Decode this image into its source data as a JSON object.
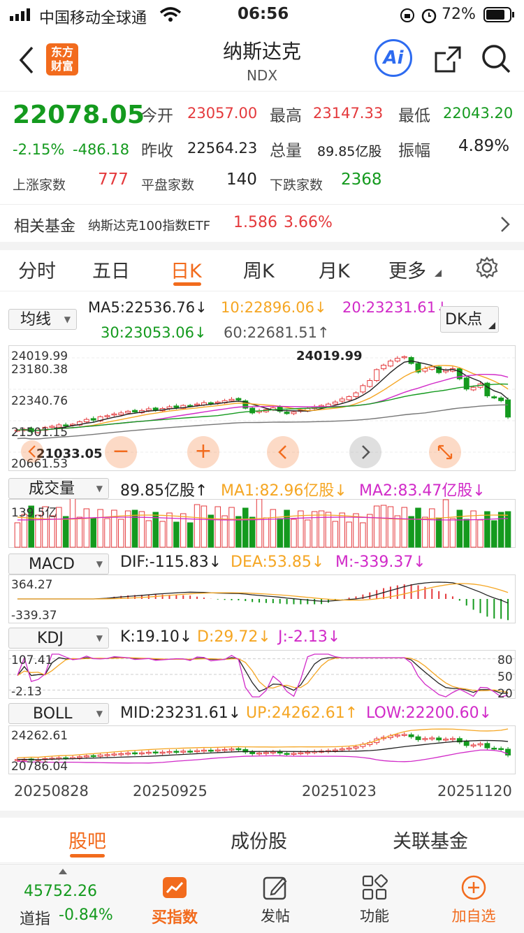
{
  "status_bar": {
    "carrier": "中国移动全球通",
    "time": "06:56",
    "battery": "72%"
  },
  "nav": {
    "logo_line1": "东方",
    "logo_line2": "财富",
    "title": "纳斯达克",
    "subtitle": "NDX",
    "ai_label": "Ai"
  },
  "quote": {
    "price": "22078.05",
    "change_pct": "-2.15%",
    "change_abs": "-486.18",
    "open_label": "今开",
    "open": "23057.00",
    "high_label": "最高",
    "high": "23147.33",
    "low_label": "最低",
    "low": "22043.20",
    "prev_label": "昨收",
    "prev": "22564.23",
    "vol_label": "总量",
    "vol": "89.85亿股",
    "amp_label": "振幅",
    "amp": "4.89%",
    "up_label": "上涨家数",
    "up": "777",
    "flat_label": "平盘家数",
    "flat": "140",
    "down_label": "下跌家数",
    "down": "2368"
  },
  "fund": {
    "label": "相关基金",
    "name": "纳斯达克100指数ETF",
    "price": "1.586",
    "pct": "3.66%"
  },
  "tabs": [
    "分时",
    "五日",
    "日K",
    "周K",
    "月K",
    "更多"
  ],
  "active_tab": "日K",
  "ma": {
    "selector": "均线",
    "ma5": "MA5:22536.76↓",
    "ma10": "10:22896.06↓",
    "ma20": "20:23231.61↓",
    "ma30": "30:23053.06↓",
    "ma60": "60:22681.51↑",
    "dk": "DK点"
  },
  "kline_axis": {
    "y1": "24019.99",
    "y2": "23180.38",
    "y3": "22340.76",
    "y4": "21501.15",
    "y5": "20661.53",
    "max_label": "24019.99",
    "min_label": "21033.05"
  },
  "volume": {
    "selector": "成交量",
    "value": "89.85亿股↑",
    "ma1": "MA1:82.96亿股↓",
    "ma2": "MA2:83.47亿股↓",
    "axis": "139.5亿"
  },
  "macd": {
    "selector": "MACD",
    "dif": "DIF:-115.83↓",
    "dea": "DEA:53.85↓",
    "m": "M:-339.37↓",
    "axis_top": "364.27",
    "axis_bottom": "-339.37"
  },
  "kdj": {
    "selector": "KDJ",
    "k": "K:19.10↓",
    "d": "D:29.72↓",
    "j": "J:-2.13↓",
    "axis_top": "107.41",
    "axis_bottom": "-2.13",
    "r80": "80",
    "r50": "50",
    "r20": "20"
  },
  "boll": {
    "selector": "BOLL",
    "mid": "MID:23231.61↓",
    "up": "UP:24262.61↑",
    "low": "LOW:22200.60↓",
    "axis_top": "24262.61",
    "axis_bottom": "20786.04"
  },
  "dates": [
    "20250828",
    "20250925",
    "20251023",
    "20251120"
  ],
  "bottom_tabs": [
    "股吧",
    "成份股",
    "关联基金"
  ],
  "bottom_bar": {
    "index_value": "45752.26",
    "index_name": "道指",
    "index_pct": "-0.84%",
    "buy": "买指数",
    "post": "发帖",
    "func": "功能",
    "add": "加自选"
  },
  "colors": {
    "up": "#e4393c",
    "down": "#149a1e",
    "accent": "#f26b1d",
    "ma10": "#f5a623",
    "ma20": "#d12ac8"
  },
  "chart_data": {
    "type": "candlestick",
    "closes": [
      21700,
      21720,
      21650,
      21690,
      21780,
      21810,
      21850,
      21830,
      21870,
      21940,
      22010,
      21990,
      22090,
      22120,
      22170,
      22200,
      22250,
      22230,
      22270,
      22320,
      22290,
      22330,
      22380,
      22360,
      22420,
      22410,
      22460,
      22500,
      22470,
      22520,
      22560,
      22600,
      22580,
      22340,
      22200,
      22260,
      22300,
      22350,
      22250,
      22180,
      22230,
      22280,
      22330,
      22380,
      22420,
      22460,
      22520,
      22610,
      22680,
      22790,
      23000,
      23150,
      23470,
      23600,
      23720,
      23800,
      23850,
      23650,
      23400,
      23500,
      23550,
      23380,
      23450,
      23500,
      23200,
      22900,
      22950,
      23050,
      22700,
      22640,
      22560,
      22078
    ]
  }
}
